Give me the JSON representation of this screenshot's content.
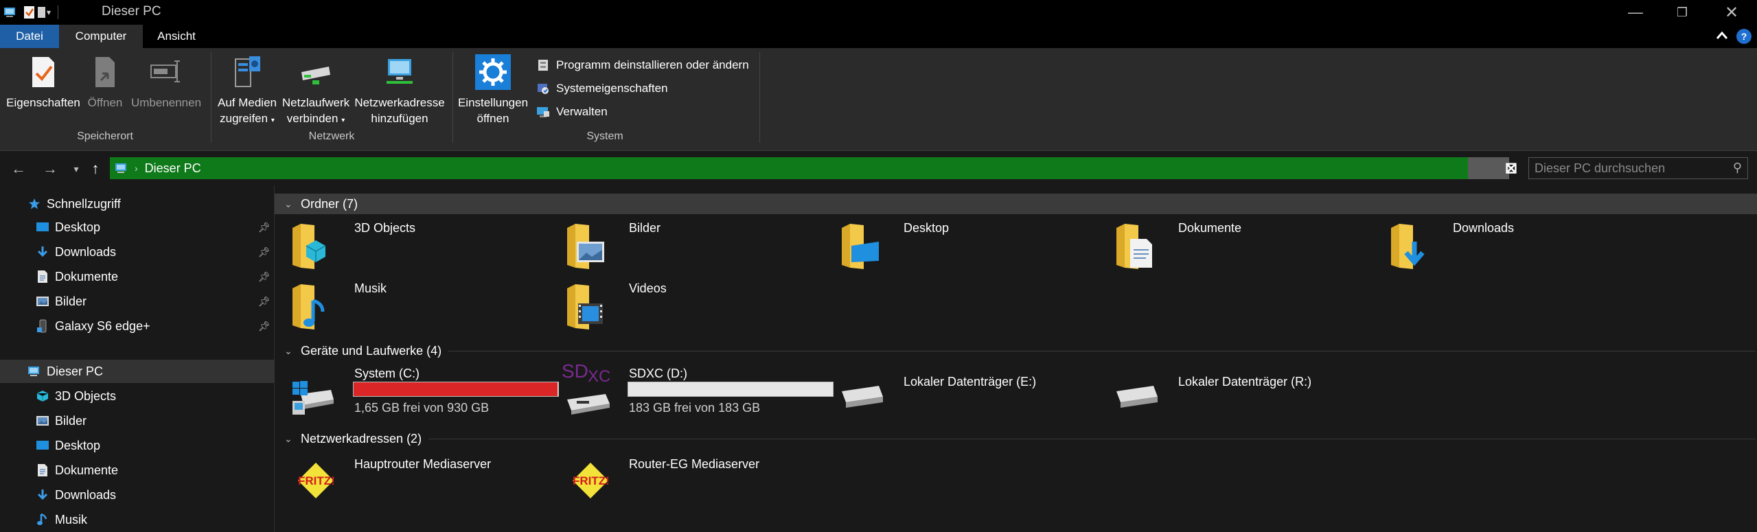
{
  "window": {
    "title": "Dieser PC"
  },
  "ribbon": {
    "tabs": [
      "Datei",
      "Computer",
      "Ansicht"
    ],
    "groups": {
      "speicherort": {
        "label": "Speicherort",
        "eigenschaften": "Eigenschaften",
        "oeffnen": "Öffnen",
        "umbenennen": "Umbenennen"
      },
      "netzwerk": {
        "label": "Netzwerk",
        "medien_l1": "Auf Medien",
        "medien_l2": "zugreifen",
        "netzlaufwerk_l1": "Netzlaufwerk",
        "netzlaufwerk_l2": "verbinden",
        "netzwerkadresse_l1": "Netzwerkadresse",
        "netzwerkadresse_l2": "hinzufügen"
      },
      "system": {
        "label": "System",
        "einstellungen_l1": "Einstellungen",
        "einstellungen_l2": "öffnen",
        "programm": "Programm deinstallieren oder ändern",
        "systemeigenschaften": "Systemeigenschaften",
        "verwalten": "Verwalten"
      }
    }
  },
  "navigation": {
    "address": "Dieser PC",
    "search_placeholder": "Dieser PC durchsuchen"
  },
  "sidebar": {
    "schnellzugriff": "Schnellzugriff",
    "quick": [
      "Desktop",
      "Downloads",
      "Dokumente",
      "Bilder",
      "Galaxy S6 edge+"
    ],
    "dieser_pc": "Dieser PC",
    "pc_items": [
      "3D Objects",
      "Bilder",
      "Desktop",
      "Dokumente",
      "Downloads",
      "Musik"
    ]
  },
  "content": {
    "folders_header": "Ordner (7)",
    "folders": [
      "3D Objects",
      "Bilder",
      "Desktop",
      "Dokumente",
      "Downloads",
      "Musik",
      "Videos"
    ],
    "drives_header": "Geräte und Laufwerke (4)",
    "drives": [
      {
        "name": "System (C:)",
        "free": "1,65 GB frei von 930 GB",
        "used_fraction": 0.998,
        "bar_color": "#da2626"
      },
      {
        "name": "SDXC (D:)",
        "free": "183 GB frei von 183 GB",
        "used_fraction": 0.0,
        "bar_color": "#26a0da"
      },
      {
        "name": "Lokaler Datenträger (E:)"
      },
      {
        "name": "Lokaler Datenträger (R:)"
      }
    ],
    "network_header": "Netzwerkadressen (2)",
    "network": [
      "Hauptrouter Mediaserver",
      "Router-EG Mediaserver"
    ],
    "sdxc_logo_text": "SDXC"
  },
  "colors": {
    "accent_blue": "#1f5fa6",
    "address_green": "#0f7a1a",
    "folder_yellow": "#f3c94a",
    "drive_full_red": "#da2626"
  }
}
